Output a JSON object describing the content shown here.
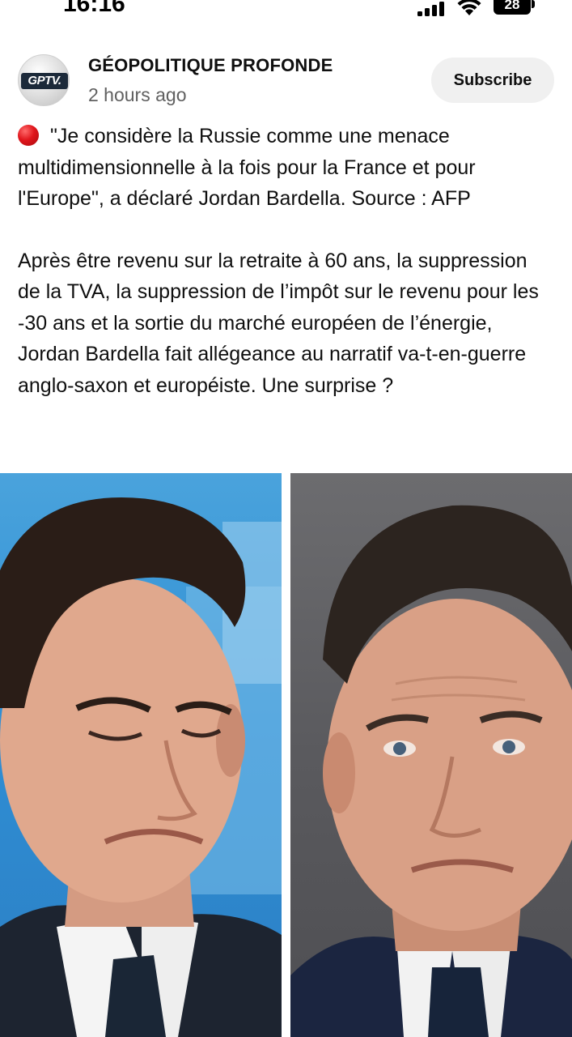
{
  "status_bar": {
    "time": "16:16",
    "battery_level": "28",
    "icons": [
      "signal-icon",
      "wifi-icon",
      "battery-icon"
    ]
  },
  "post": {
    "channel": {
      "name": "GÉOPOLITIQUE PROFONDE",
      "avatar_text": "GPTV.",
      "time": "2 hours ago"
    },
    "subscribe_label": "Subscribe",
    "bullet_icon": "red-circle-icon",
    "paragraphs": [
      "\"Je considère la Russie comme une menace multidimensionnelle à la fois pour la France et pour l'Europe\", a déclaré Jordan Bardella. Source : AFP",
      "Après être revenu sur la retraite à 60 ans, la suppression de la TVA, la suppression de l’impôt sur le revenu pour les -30 ans et la sortie du marché européen de l’énergie, Jordan Bardella fait allégeance au narratif va-t-en-guerre anglo-saxon et européiste. Une surprise ?"
    ],
    "image": {
      "panels": [
        "left-portrait",
        "right-portrait"
      ]
    }
  },
  "colors": {
    "subscribe_bg": "#f0f0f0",
    "secondary_text": "#606060",
    "bullet": "#e0161c"
  }
}
